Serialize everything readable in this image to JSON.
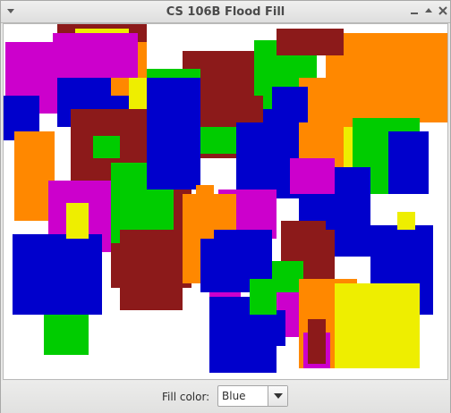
{
  "window": {
    "title": "CS 106B Flood Fill"
  },
  "icons": {
    "window_menu": "down-arrow-icon",
    "minimize": "minimize-icon",
    "maximize": "maximize-icon",
    "close": "close-icon",
    "dropdown": "chevron-down-icon"
  },
  "controls": {
    "fill_color_label": "Fill color:",
    "fill_color_selected": "Blue",
    "fill_color_options_visible": [
      "Blue"
    ]
  },
  "palette": {
    "green": "#00cc00",
    "blue": "#0000cc",
    "magenta": "#cc00cc",
    "orange": "#ff8800",
    "yellow": "#eeee00",
    "maroon": "#8c1a1a",
    "white": "#ffffff"
  },
  "rectangles": [
    {
      "c": "maroon"
    },
    {
      "c": "magenta"
    },
    {
      "c": "green"
    },
    {
      "c": "orange"
    },
    {
      "c": "yellow"
    },
    {
      "c": "blue"
    },
    {
      "c": "maroon"
    },
    {
      "c": "green"
    },
    {
      "c": "orange"
    },
    {
      "c": "magenta"
    },
    {
      "c": "blue"
    },
    {
      "c": "yellow"
    },
    {
      "c": "maroon"
    },
    {
      "c": "green"
    },
    {
      "c": "orange"
    },
    {
      "c": "blue"
    },
    {
      "c": "magenta"
    },
    {
      "c": "maroon"
    },
    {
      "c": "green"
    },
    {
      "c": "blue"
    },
    {
      "c": "orange"
    },
    {
      "c": "maroon"
    },
    {
      "c": "yellow"
    },
    {
      "c": "green"
    },
    {
      "c": "blue"
    },
    {
      "c": "magenta"
    },
    {
      "c": "maroon"
    },
    {
      "c": "orange"
    },
    {
      "c": "blue"
    },
    {
      "c": "green"
    },
    {
      "c": "magenta"
    },
    {
      "c": "blue"
    },
    {
      "c": "maroon"
    },
    {
      "c": "yellow"
    },
    {
      "c": "orange"
    },
    {
      "c": "green"
    },
    {
      "c": "blue"
    },
    {
      "c": "magenta"
    },
    {
      "c": "maroon"
    },
    {
      "c": "blue"
    },
    {
      "c": "green"
    },
    {
      "c": "orange"
    },
    {
      "c": "yellow"
    },
    {
      "c": "blue"
    },
    {
      "c": "magenta"
    },
    {
      "c": "maroon"
    },
    {
      "c": "blue"
    },
    {
      "c": "green"
    },
    {
      "c": "orange"
    },
    {
      "c": "blue"
    },
    {
      "c": "maroon"
    },
    {
      "c": "magenta"
    },
    {
      "c": "green"
    },
    {
      "c": "blue"
    },
    {
      "c": "yellow"
    }
  ]
}
